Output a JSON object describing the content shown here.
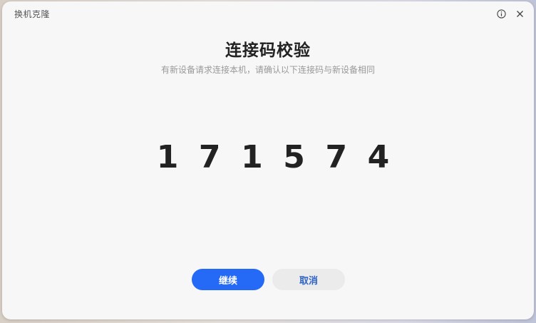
{
  "window": {
    "title": "换机克隆"
  },
  "titlebar": {
    "info_icon": "info-circle-icon",
    "close_icon": "close-icon"
  },
  "main": {
    "heading": "连接码校验",
    "subtitle": "有新设备请求连接本机，请确认以下连接码与新设备相同",
    "code_digits": [
      "1",
      "7",
      "1",
      "5",
      "7",
      "4"
    ]
  },
  "buttons": {
    "continue_label": "继续",
    "cancel_label": "取消"
  },
  "colors": {
    "accent": "#256af6",
    "cancel_text": "#2e63c7",
    "window_bg": "#f7f7f7"
  }
}
